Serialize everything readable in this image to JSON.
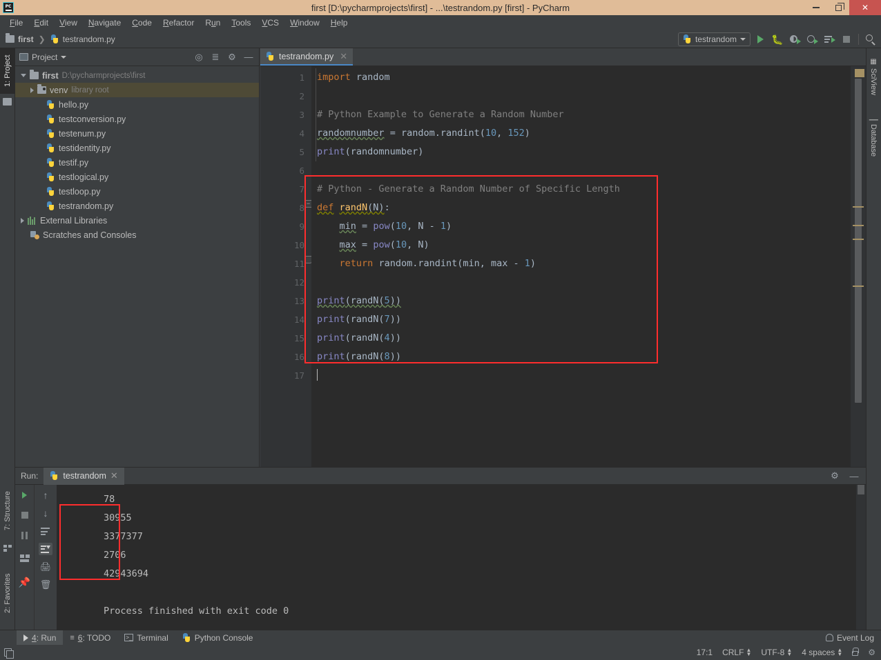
{
  "window": {
    "title": "first [D:\\pycharmprojects\\first] - ...\\testrandom.py [first] - PyCharm",
    "logo_text": "PC"
  },
  "menubar": {
    "items": [
      {
        "label": "File",
        "mnemonic": "F"
      },
      {
        "label": "Edit",
        "mnemonic": "E"
      },
      {
        "label": "View",
        "mnemonic": "V"
      },
      {
        "label": "Navigate",
        "mnemonic": "N"
      },
      {
        "label": "Code",
        "mnemonic": "C"
      },
      {
        "label": "Refactor",
        "mnemonic": "R"
      },
      {
        "label": "Run",
        "mnemonic": "u"
      },
      {
        "label": "Tools",
        "mnemonic": "T"
      },
      {
        "label": "VCS",
        "mnemonic": "V"
      },
      {
        "label": "Window",
        "mnemonic": "W"
      },
      {
        "label": "Help",
        "mnemonic": "H"
      }
    ]
  },
  "navbar": {
    "breadcrumb": [
      "first",
      "testrandom.py"
    ],
    "run_config": "testrandom"
  },
  "left_tool_tabs": [
    {
      "label": "1: Project",
      "active": true
    },
    {
      "label": "2: Favorites",
      "active": false
    },
    {
      "label": "7: Structure",
      "active": false
    }
  ],
  "right_tool_tabs": [
    {
      "label": "SciView"
    },
    {
      "label": "Database"
    }
  ],
  "project_panel": {
    "title": "Project",
    "tree": [
      {
        "label": "first",
        "detail": "D:\\pycharmprojects\\first",
        "depth": 0,
        "icon": "folder-icon",
        "expand": "down",
        "bold": true,
        "selected": false
      },
      {
        "label": "venv",
        "detail": "library root",
        "depth": 1,
        "icon": "venv-folder-icon",
        "expand": "right",
        "bold": false,
        "selected": true
      },
      {
        "label": "hello.py",
        "detail": "",
        "depth": 2,
        "icon": "python-file-icon",
        "expand": "none",
        "bold": false,
        "selected": false
      },
      {
        "label": "testconversion.py",
        "detail": "",
        "depth": 2,
        "icon": "python-file-icon",
        "expand": "none",
        "bold": false,
        "selected": false
      },
      {
        "label": "testenum.py",
        "detail": "",
        "depth": 2,
        "icon": "python-file-icon",
        "expand": "none",
        "bold": false,
        "selected": false
      },
      {
        "label": "testidentity.py",
        "detail": "",
        "depth": 2,
        "icon": "python-file-icon",
        "expand": "none",
        "bold": false,
        "selected": false
      },
      {
        "label": "testif.py",
        "detail": "",
        "depth": 2,
        "icon": "python-file-icon",
        "expand": "none",
        "bold": false,
        "selected": false
      },
      {
        "label": "testlogical.py",
        "detail": "",
        "depth": 2,
        "icon": "python-file-icon",
        "expand": "none",
        "bold": false,
        "selected": false
      },
      {
        "label": "testloop.py",
        "detail": "",
        "depth": 2,
        "icon": "python-file-icon",
        "expand": "none",
        "bold": false,
        "selected": false
      },
      {
        "label": "testrandom.py",
        "detail": "",
        "depth": 2,
        "icon": "python-file-icon",
        "expand": "none",
        "bold": false,
        "selected": false
      },
      {
        "label": "External Libraries",
        "detail": "",
        "depth": 0,
        "icon": "library-icon",
        "expand": "right",
        "bold": false,
        "selected": false
      },
      {
        "label": "Scratches and Consoles",
        "detail": "",
        "depth": 0,
        "icon": "scratches-icon",
        "expand": "none",
        "bold": false,
        "selected": false
      }
    ]
  },
  "editor": {
    "tab_label": "testrandom.py",
    "lines": [
      {
        "n": "1",
        "text": "import random"
      },
      {
        "n": "2",
        "text": ""
      },
      {
        "n": "3",
        "text": "# Python Example to Generate a Random Number"
      },
      {
        "n": "4",
        "text": "randomnumber = random.randint(10, 152)"
      },
      {
        "n": "5",
        "text": "print(randomnumber)"
      },
      {
        "n": "6",
        "text": ""
      },
      {
        "n": "7",
        "text": "# Python - Generate a Random Number of Specific Length"
      },
      {
        "n": "8",
        "text": "def randN(N):"
      },
      {
        "n": "9",
        "text": "    min = pow(10, N - 1)"
      },
      {
        "n": "10",
        "text": "    max = pow(10, N)"
      },
      {
        "n": "11",
        "text": "    return random.randint(min, max - 1)"
      },
      {
        "n": "12",
        "text": ""
      },
      {
        "n": "13",
        "text": "print(randN(5))"
      },
      {
        "n": "14",
        "text": "print(randN(7))"
      },
      {
        "n": "15",
        "text": "print(randN(4))"
      },
      {
        "n": "16",
        "text": "print(randN(8))"
      },
      {
        "n": "17",
        "text": ""
      }
    ],
    "highlight_color": "#ff2d2d"
  },
  "run_panel": {
    "label": "Run:",
    "tab_label": "testrandom",
    "output": [
      "78",
      "30955",
      "3377377",
      "2706",
      "42943694",
      "",
      "Process finished with exit code 0"
    ],
    "highlighted_output": [
      "30955",
      "3377377",
      "2706",
      "42943694"
    ]
  },
  "bottom_bar": {
    "items": [
      {
        "label": "4: Run",
        "mnemonic": "4",
        "icon": "run-icon",
        "active": true
      },
      {
        "label": "6: TODO",
        "mnemonic": "6",
        "icon": "todo-icon",
        "active": false
      },
      {
        "label": "Terminal",
        "mnemonic": "",
        "icon": "terminal-icon",
        "active": false
      },
      {
        "label": "Python Console",
        "mnemonic": "",
        "icon": "python-console-icon",
        "active": false
      }
    ],
    "event_log": "Event Log"
  },
  "status_bar": {
    "caret_position": "17:1",
    "line_separator": "CRLF",
    "encoding": "UTF-8",
    "indent": "4 spaces"
  },
  "colors": {
    "titlebar_bg": "#e0bc98",
    "chrome_bg": "#3c3f41",
    "editor_bg": "#2b2b2b",
    "accent_blue": "#4a88c7",
    "run_green": "#59a869",
    "keyword_orange": "#cc7832",
    "number_blue": "#6897bb",
    "comment_gray": "#808080",
    "function_yellow": "#ffc66d",
    "text_fg": "#a9b7c6",
    "selection_olive": "#4e4a36",
    "close_red": "#c75450",
    "annotation_red": "#ff2d2d"
  }
}
